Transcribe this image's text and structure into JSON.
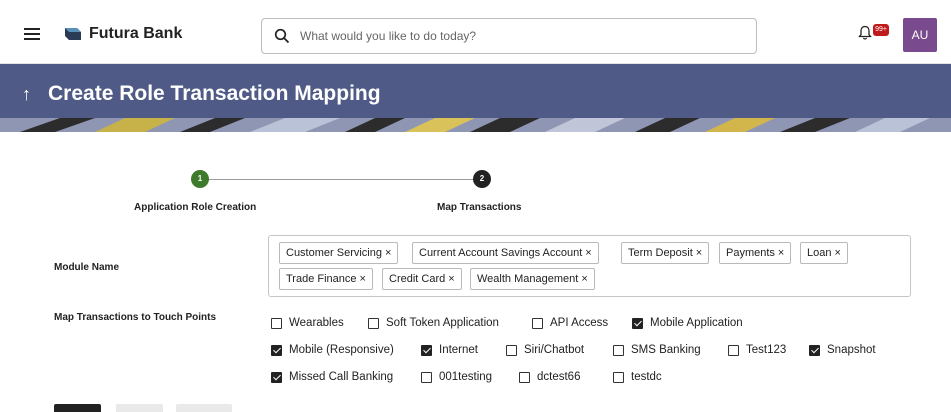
{
  "header": {
    "brand": "Futura Bank",
    "search_placeholder": "What would you like to do today?",
    "notification_badge": "99+",
    "avatar_initials": "AU"
  },
  "banner": {
    "title": "Create Role Transaction Mapping",
    "color": "#4f5b86"
  },
  "stepper": {
    "steps": [
      {
        "number": "1",
        "label": "Application Role Creation",
        "status": "completed",
        "color": "#3e7a2c"
      },
      {
        "number": "2",
        "label": "Map Transactions",
        "status": "current",
        "color": "#222222"
      }
    ]
  },
  "form": {
    "module_label": "Module Name",
    "modules": [
      "Customer Servicing",
      "Current Account Savings Account",
      "Term Deposit",
      "Payments",
      "Loan",
      "Trade Finance",
      "Credit Card",
      "Wealth Management"
    ],
    "touchpoints_label": "Map Transactions to Touch Points",
    "touchpoints": [
      {
        "label": "Wearables",
        "checked": false
      },
      {
        "label": "Soft Token Application",
        "checked": false
      },
      {
        "label": "API Access",
        "checked": false
      },
      {
        "label": "Mobile Application",
        "checked": true
      },
      {
        "label": "Mobile (Responsive)",
        "checked": true
      },
      {
        "label": "Internet",
        "checked": true
      },
      {
        "label": "Siri/Chatbot",
        "checked": false
      },
      {
        "label": "SMS Banking",
        "checked": false
      },
      {
        "label": "Test123",
        "checked": false
      },
      {
        "label": "Snapshot",
        "checked": true
      },
      {
        "label": "Missed Call Banking",
        "checked": true
      },
      {
        "label": "001testing",
        "checked": false
      },
      {
        "label": "dctest66",
        "checked": false
      },
      {
        "label": "testdc",
        "checked": false
      }
    ]
  }
}
